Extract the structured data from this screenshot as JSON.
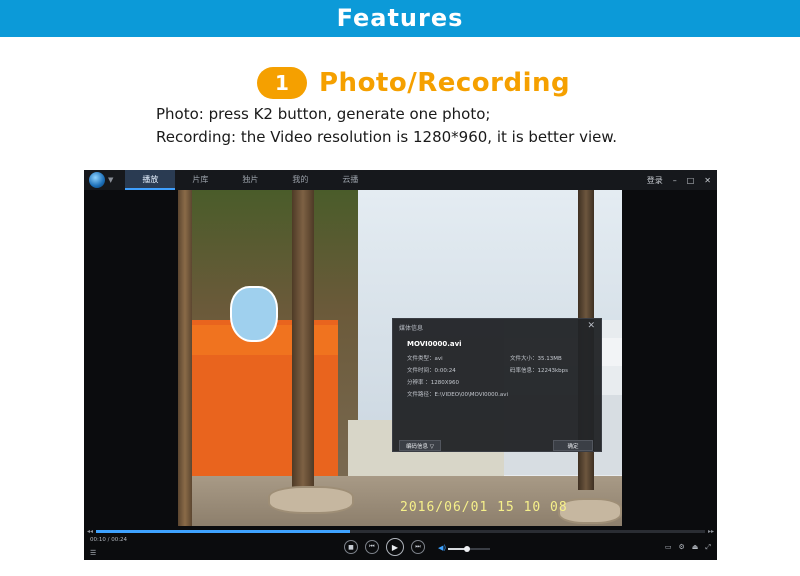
{
  "banner": {
    "title": "Features"
  },
  "section": {
    "number": "1",
    "title": "Photo/Recording",
    "lines": [
      "Photo: press K2 button, generate one photo;",
      "Recording: the Video resolution is 1280*960, it is better view."
    ]
  },
  "player": {
    "tabs": [
      "播放",
      "片库",
      "独片",
      "我的",
      "云播"
    ],
    "active_tab": "播放",
    "login_label": "登录",
    "window_controls": [
      "–",
      "□",
      "✕"
    ],
    "video_timestamp": "2016/06/01  15  10  08",
    "dialog": {
      "title": "媒体信息",
      "close": "✕",
      "file_name": "MOVI0000.avi",
      "file_type": "文件类型：avi",
      "file_size": "文件大小：35.13MB",
      "duration": "文件时间：0:00:24",
      "bitrate": "码率信息：12243kbps",
      "resolution": "分辨率    ：1280X960",
      "path": "文件路径：E:\\VIDEO\\00\\MOVI0000.avi",
      "codec_button": "编码信息 ▽",
      "ok_button": "确定"
    },
    "progress": {
      "current": "00:10",
      "total": "00:24",
      "fraction": 0.417
    },
    "time_label": "00:10 / 00:24",
    "volume": {
      "fraction": 0.45
    },
    "icons": {
      "logo": "globe-logo-icon",
      "stop": "stop-icon",
      "prev": "previous-icon",
      "play": "play-icon",
      "next": "next-icon",
      "volume": "volume-icon",
      "playlist": "playlist-icon",
      "screen": "screen-icon",
      "settings": "settings-icon",
      "eject": "eject-icon",
      "fullscreen": "fullscreen-icon"
    },
    "colors": {
      "accent": "#3ea2ff",
      "banner": "#0c9ad8",
      "badge": "#f5a000"
    }
  }
}
